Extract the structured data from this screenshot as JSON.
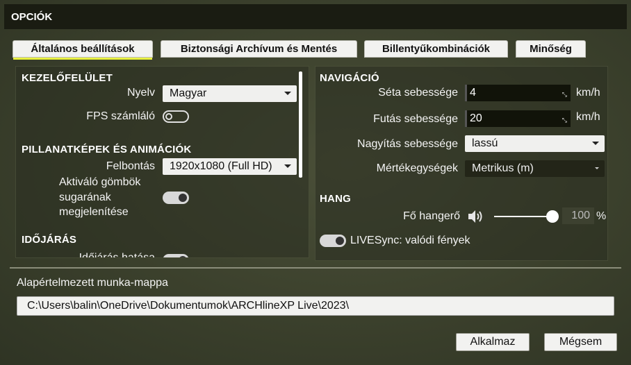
{
  "window": {
    "title": "OPCIÓK"
  },
  "tabs": [
    {
      "label": "Általános beállítások",
      "active": true
    },
    {
      "label": "Biztonsági Archívum és Mentés",
      "active": false
    },
    {
      "label": "Billentyűkombinációk",
      "active": false
    },
    {
      "label": "Minőség",
      "active": false
    }
  ],
  "left": {
    "ui_title": "KEZELŐFELÜLET",
    "language_label": "Nyelv",
    "language_value": "Magyar",
    "fps_label": "FPS számláló",
    "fps_on": false,
    "snap_title": "PILLANATKÉPEK ÉS ANIMÁCIÓK",
    "resolution_label": "Felbontás",
    "resolution_value": "1920x1080 (Full HD)",
    "activator_label_1": "Aktiváló gömbök",
    "activator_label_2": "sugarának",
    "activator_label_3": "megjelenítése",
    "activator_on": true,
    "weather_title": "IDŐJÁRÁS",
    "weather_clipped_label": "Időjárás hatása"
  },
  "right": {
    "nav_title": "NAVIGÁCIÓ",
    "walk_label": "Séta sebessége",
    "walk_value": "4",
    "walk_unit": "km/h",
    "run_label": "Futás sebessége",
    "run_value": "20",
    "run_unit": "km/h",
    "zoom_label": "Nagyítás sebessége",
    "zoom_value": "lassú",
    "units_label": "Mértékegységek",
    "units_value": "Metrikus (m)",
    "sound_title": "HANG",
    "volume_label": "Fő hangerő",
    "volume_value": "100",
    "volume_unit": "%",
    "volume_level": 1.0,
    "livesync_label": "LIVESync: valódi fények",
    "livesync_on": true
  },
  "folder": {
    "label": "Alapértelmezett munka-mappa",
    "path": "C:\\Users\\balin\\OneDrive\\Dokumentumok\\ARCHlineXP Live\\2023\\"
  },
  "buttons": {
    "apply": "Alkalmaz",
    "cancel": "Mégsem"
  },
  "colors": {
    "tab_accent": "#e8f040",
    "titlebar": "#1a1c12"
  },
  "icons": {
    "volume": "speaker-icon"
  }
}
